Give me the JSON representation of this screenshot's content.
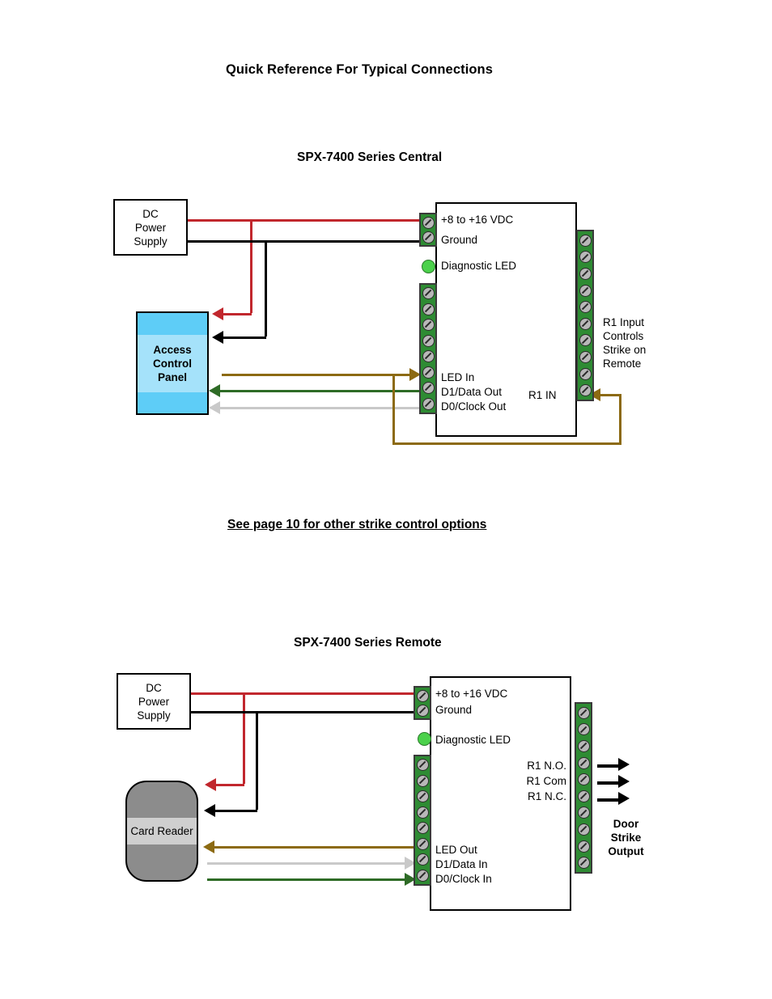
{
  "document": {
    "title": "Quick Reference For Typical Connections",
    "note": "See page 10 for other strike control options"
  },
  "colors": {
    "power_positive": "#C1272D",
    "power_ground": "#000000",
    "led_wire": "#8C6A12",
    "data1_wire": "#C9C9C9",
    "data0_wire": "#2E6B26",
    "terminal_green": "#2E8B33",
    "screw_gray": "#B8B8B8",
    "panel_blue": "#5ECDF7",
    "panel_blue_inner": "#A5E2FA",
    "reader_gray": "#8C8C8C",
    "reader_gray_inner": "#CFCFCF",
    "diagnostic_led": "#4BD14B"
  },
  "central": {
    "heading": "SPX-7400 Series Central",
    "power_supply": {
      "label": "DC\nPower\nSupply"
    },
    "access_panel": {
      "label": "Access\nControl\nPanel"
    },
    "power_terminals": [
      "+8 to +16 VDC",
      "Ground"
    ],
    "diagnostic_led_label": "Diagnostic LED",
    "signal_terminals": [
      "LED In",
      "D1/Data Out",
      "D0/Clock Out"
    ],
    "relay_label": "R1 IN",
    "relay_note": "R1 Input\nControls\nStrike on\nRemote",
    "left_strip_top_count": 2,
    "left_strip_bottom_count": 8,
    "right_strip_count": 10
  },
  "remote": {
    "heading": "SPX-7400 Series Remote",
    "power_supply": {
      "label": "DC\nPower\nSupply"
    },
    "card_reader": {
      "label": "Card\nReader"
    },
    "power_terminals": [
      "+8 to +16 VDC",
      "Ground"
    ],
    "diagnostic_led_label": "Diagnostic LED",
    "signal_terminals": [
      "LED Out",
      "D1/Data In",
      "D0/Clock In"
    ],
    "relay_terminals": [
      "R1 N.O.",
      "R1 Com",
      "R1 N.C."
    ],
    "output_label": "Door\nStrike\nOutput",
    "left_strip_top_count": 2,
    "left_strip_bottom_count": 8,
    "right_strip_count": 10
  }
}
